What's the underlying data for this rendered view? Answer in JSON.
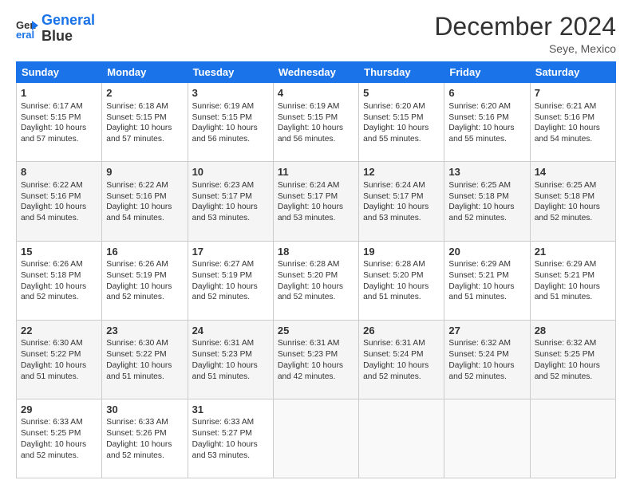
{
  "logo": {
    "line1": "General",
    "line2": "Blue"
  },
  "title": "December 2024",
  "location": "Seye, Mexico",
  "days_header": [
    "Sunday",
    "Monday",
    "Tuesday",
    "Wednesday",
    "Thursday",
    "Friday",
    "Saturday"
  ],
  "weeks": [
    [
      {
        "day": "1",
        "sunrise": "6:17 AM",
        "sunset": "5:15 PM",
        "daylight": "10 hours and 57 minutes."
      },
      {
        "day": "2",
        "sunrise": "6:18 AM",
        "sunset": "5:15 PM",
        "daylight": "10 hours and 57 minutes."
      },
      {
        "day": "3",
        "sunrise": "6:19 AM",
        "sunset": "5:15 PM",
        "daylight": "10 hours and 56 minutes."
      },
      {
        "day": "4",
        "sunrise": "6:19 AM",
        "sunset": "5:15 PM",
        "daylight": "10 hours and 56 minutes."
      },
      {
        "day": "5",
        "sunrise": "6:20 AM",
        "sunset": "5:15 PM",
        "daylight": "10 hours and 55 minutes."
      },
      {
        "day": "6",
        "sunrise": "6:20 AM",
        "sunset": "5:16 PM",
        "daylight": "10 hours and 55 minutes."
      },
      {
        "day": "7",
        "sunrise": "6:21 AM",
        "sunset": "5:16 PM",
        "daylight": "10 hours and 54 minutes."
      }
    ],
    [
      {
        "day": "8",
        "sunrise": "6:22 AM",
        "sunset": "5:16 PM",
        "daylight": "10 hours and 54 minutes."
      },
      {
        "day": "9",
        "sunrise": "6:22 AM",
        "sunset": "5:16 PM",
        "daylight": "10 hours and 54 minutes."
      },
      {
        "day": "10",
        "sunrise": "6:23 AM",
        "sunset": "5:17 PM",
        "daylight": "10 hours and 53 minutes."
      },
      {
        "day": "11",
        "sunrise": "6:24 AM",
        "sunset": "5:17 PM",
        "daylight": "10 hours and 53 minutes."
      },
      {
        "day": "12",
        "sunrise": "6:24 AM",
        "sunset": "5:17 PM",
        "daylight": "10 hours and 53 minutes."
      },
      {
        "day": "13",
        "sunrise": "6:25 AM",
        "sunset": "5:18 PM",
        "daylight": "10 hours and 52 minutes."
      },
      {
        "day": "14",
        "sunrise": "6:25 AM",
        "sunset": "5:18 PM",
        "daylight": "10 hours and 52 minutes."
      }
    ],
    [
      {
        "day": "15",
        "sunrise": "6:26 AM",
        "sunset": "5:18 PM",
        "daylight": "10 hours and 52 minutes."
      },
      {
        "day": "16",
        "sunrise": "6:26 AM",
        "sunset": "5:19 PM",
        "daylight": "10 hours and 52 minutes."
      },
      {
        "day": "17",
        "sunrise": "6:27 AM",
        "sunset": "5:19 PM",
        "daylight": "10 hours and 52 minutes."
      },
      {
        "day": "18",
        "sunrise": "6:28 AM",
        "sunset": "5:20 PM",
        "daylight": "10 hours and 52 minutes."
      },
      {
        "day": "19",
        "sunrise": "6:28 AM",
        "sunset": "5:20 PM",
        "daylight": "10 hours and 51 minutes."
      },
      {
        "day": "20",
        "sunrise": "6:29 AM",
        "sunset": "5:21 PM",
        "daylight": "10 hours and 51 minutes."
      },
      {
        "day": "21",
        "sunrise": "6:29 AM",
        "sunset": "5:21 PM",
        "daylight": "10 hours and 51 minutes."
      }
    ],
    [
      {
        "day": "22",
        "sunrise": "6:30 AM",
        "sunset": "5:22 PM",
        "daylight": "10 hours and 51 minutes."
      },
      {
        "day": "23",
        "sunrise": "6:30 AM",
        "sunset": "5:22 PM",
        "daylight": "10 hours and 51 minutes."
      },
      {
        "day": "24",
        "sunrise": "6:31 AM",
        "sunset": "5:23 PM",
        "daylight": "10 hours and 51 minutes."
      },
      {
        "day": "25",
        "sunrise": "6:31 AM",
        "sunset": "5:23 PM",
        "daylight": "10 hours and 42 minutes."
      },
      {
        "day": "26",
        "sunrise": "6:31 AM",
        "sunset": "5:24 PM",
        "daylight": "10 hours and 52 minutes."
      },
      {
        "day": "27",
        "sunrise": "6:32 AM",
        "sunset": "5:24 PM",
        "daylight": "10 hours and 52 minutes."
      },
      {
        "day": "28",
        "sunrise": "6:32 AM",
        "sunset": "5:25 PM",
        "daylight": "10 hours and 52 minutes."
      }
    ],
    [
      {
        "day": "29",
        "sunrise": "6:33 AM",
        "sunset": "5:25 PM",
        "daylight": "10 hours and 52 minutes."
      },
      {
        "day": "30",
        "sunrise": "6:33 AM",
        "sunset": "5:26 PM",
        "daylight": "10 hours and 52 minutes."
      },
      {
        "day": "31",
        "sunrise": "6:33 AM",
        "sunset": "5:27 PM",
        "daylight": "10 hours and 53 minutes."
      },
      null,
      null,
      null,
      null
    ]
  ]
}
